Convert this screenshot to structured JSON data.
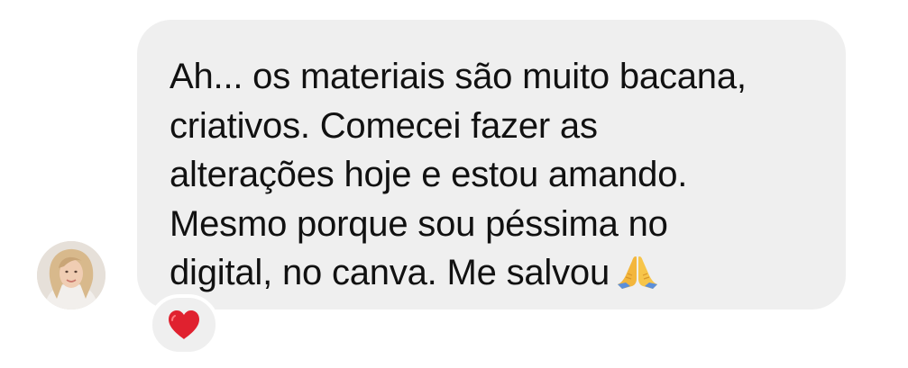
{
  "message": {
    "lines": [
      "Ah... os materiais são muito bacana,",
      "criativos. Comecei  fazer as",
      "alterações hoje e estou amando.",
      "Mesmo porque sou péssima no",
      "digital, no canva. Me salvou"
    ],
    "trailing_emoji": "folded-hands-icon"
  },
  "reaction": {
    "emoji": "red-heart-icon",
    "color": "#e0212f"
  },
  "sender": {
    "avatar": "profile-photo"
  },
  "colors": {
    "bubble": "#efefef",
    "text": "#111111",
    "background": "#ffffff"
  }
}
